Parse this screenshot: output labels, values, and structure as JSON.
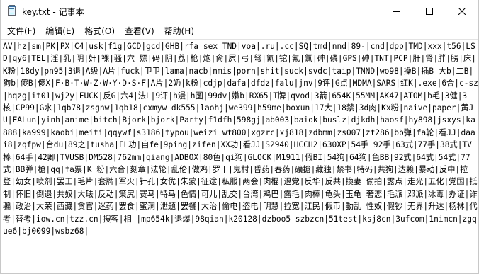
{
  "window": {
    "title": "key.txt - 记事本",
    "icon": "notepad-icon",
    "controls": {
      "minimize_icon": "minimize-icon",
      "maximize_icon": "maximize-icon",
      "close_icon": "close-icon"
    }
  },
  "menu": {
    "items": [
      {
        "label": "文件(F)"
      },
      {
        "label": "编辑(E)"
      },
      {
        "label": "格式(O)"
      },
      {
        "label": "查看(V)"
      },
      {
        "label": "帮助(H)"
      }
    ]
  },
  "editor": {
    "content": "AV|hz|sm|PK|PX|C4|usk|f1g|GCD|gcd|GHB|rfa|sex|TND|voa|.ru|.cc|SQ|tmd|nnd|89-|cnd|dpp|TMD|xxx|t56|LSD|qy6|TEL|淫|乳|阴|奸|裸|骚|穴|嫖|码|阴|荔|枪|炮|肏|屄|弓|弩|氰|铊|氟|氯|砷|磷|GPS|砷|TNT|PCP|肝|肾|胖|膀|床|K粉|18dy|pn95|3退|A级|A片|fuck|卫卫|lama|nacb|nmis|porn|shit|suck|svdc|taip|TNND|wo98|操B|插B|大b|二B|狗b|傻B|傻X|F·B·T·W·Z·W·Y·D·S·F|A片|2奶|k粉|cdjp|dafa|dfdz|falu|jnv|9评|G点|MDMA|SARS|红K|.exe|6合|c-sz|hqzg|it01|wj2y|FUCK|反G|六4|法L|9评|h漫|h图|99dv|嫩b|RX65|T牌|qvod|3箭|654K|55MM|AK47|ATOM|b毛|3健|3核|CP99|G水|1qb78|zsgnw|1qb18|cxmyw|dk555|laohj|we399|h59me|boxun|17大|18禁|3d肉|Kx粉|naive|paper|黄JU|FALun|yinh|anime|bitch|Bjork|bjork|Party|f1dfh|598gj|ab003|baiok|buslz|djkdh|haosf|hy898|jsxys|ka888|ka999|kaobi|meiti|qqywf|s3186|typou|weizi|wt800|xgzrc|xj818|zdbmm|zs007|zt286|bb弹|fa轮|看JJ|daai8|zqfpw|台du|89之|tusha|FL功|自fe|9ping|zifen|XX功|看JJ|S2940|HCCH2|630XP|54手|92手|63式|77手|38式|TV棒|64手|42卿|TVUSB|DM528|762mm|qiang|ADBOX|80色|qi狗|GLOCK|M1911|假BI|54狗|64狗|色BB|92式|64式|54式|77式|BB弹|槍|qq|fa票|K 粉|六合|刻章|法轮|乱伦|做鸡|罗干|鬼村|昏药|春药|礦搶|藏独|禁书|特码|共狗|达赖|暴动|反中|拉登|幼女|喷剂|罢工|毛片|套牌|军火|针孔|女优|朱蒙|征途|私服|两会|肉棍|退党|反华|反共|換妻|偷拍|露点|走光|五化|党国|抵制|怀旧|倒退|共奴|大珐|反动|策尻|赛马|特马|色情|可儿|乱交|台湾|鸡巴|露毛|肉棒|龟头|玉龟|奢恋|毛派|邓派|冰毒|办证|诈骗|政治|大荣|西藏|贪官|迷药|罢食|蜜洞|泄题|罢餐|大治|偷电|盗电|明慧|拉宽|江民|假币|動乱|性奴|假钞|无界|升达|杨林|代考|替考|iow.cn|tzz.cn|搜客|相 |mp654k|退爆|98qian|k20128|dzboo5|szbzcn|51test|ksj8cn|3ufcom|1nimcn|zgque6|bj0099|wsbz68|"
  }
}
